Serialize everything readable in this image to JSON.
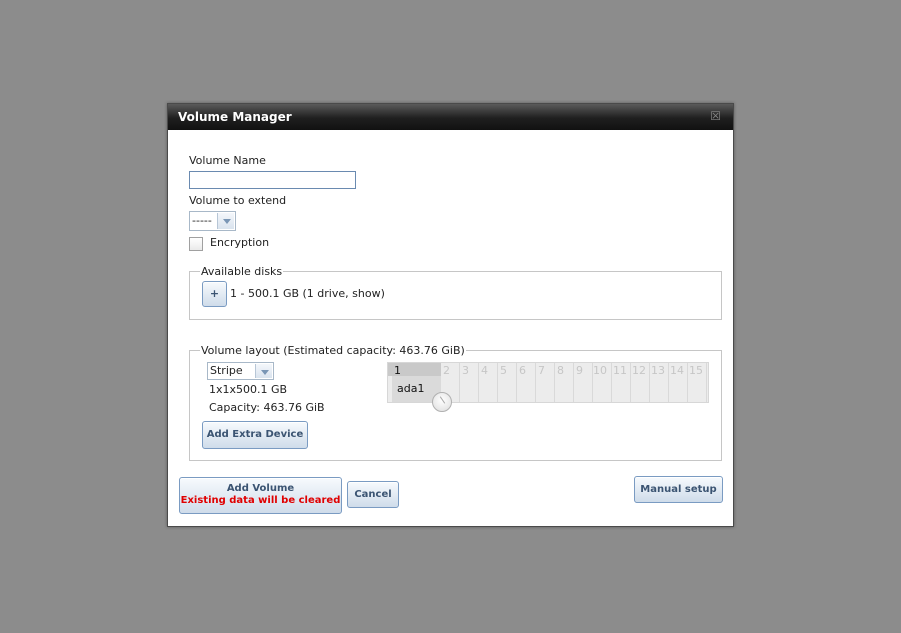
{
  "dialog": {
    "title": "Volume Manager",
    "close_icon": "close-icon"
  },
  "form": {
    "volume_name_label": "Volume Name",
    "volume_name_value": "",
    "volume_extend_label": "Volume to extend",
    "volume_extend_value": "-----",
    "encryption_label": "Encryption",
    "encryption_checked": false
  },
  "available_disks": {
    "legend": "Available disks",
    "add_button": "+",
    "summary": "1 - 500.1 GB (1 drive, show)"
  },
  "volume_layout": {
    "legend": "Volume layout (Estimated capacity: 463.76 GiB)",
    "layout_value": "Stripe",
    "geometry": "1x1x500.1 GB",
    "capacity": "Capacity: 463.76 GiB",
    "add_extra_device": "Add Extra Device",
    "selected_rows": 1,
    "disk_label": "ada1",
    "columns": [
      "1",
      "2",
      "3",
      "4",
      "5",
      "6",
      "7",
      "8",
      "9",
      "10",
      "11",
      "12",
      "13",
      "14",
      "15"
    ]
  },
  "buttons": {
    "add_volume": "Add Volume",
    "add_volume_warning": "Existing data will be cleared",
    "cancel": "Cancel",
    "manual_setup": "Manual setup"
  },
  "colors": {
    "overlay": "#8c8c8c",
    "warning": "#e00000",
    "button_text": "#3b5472"
  }
}
